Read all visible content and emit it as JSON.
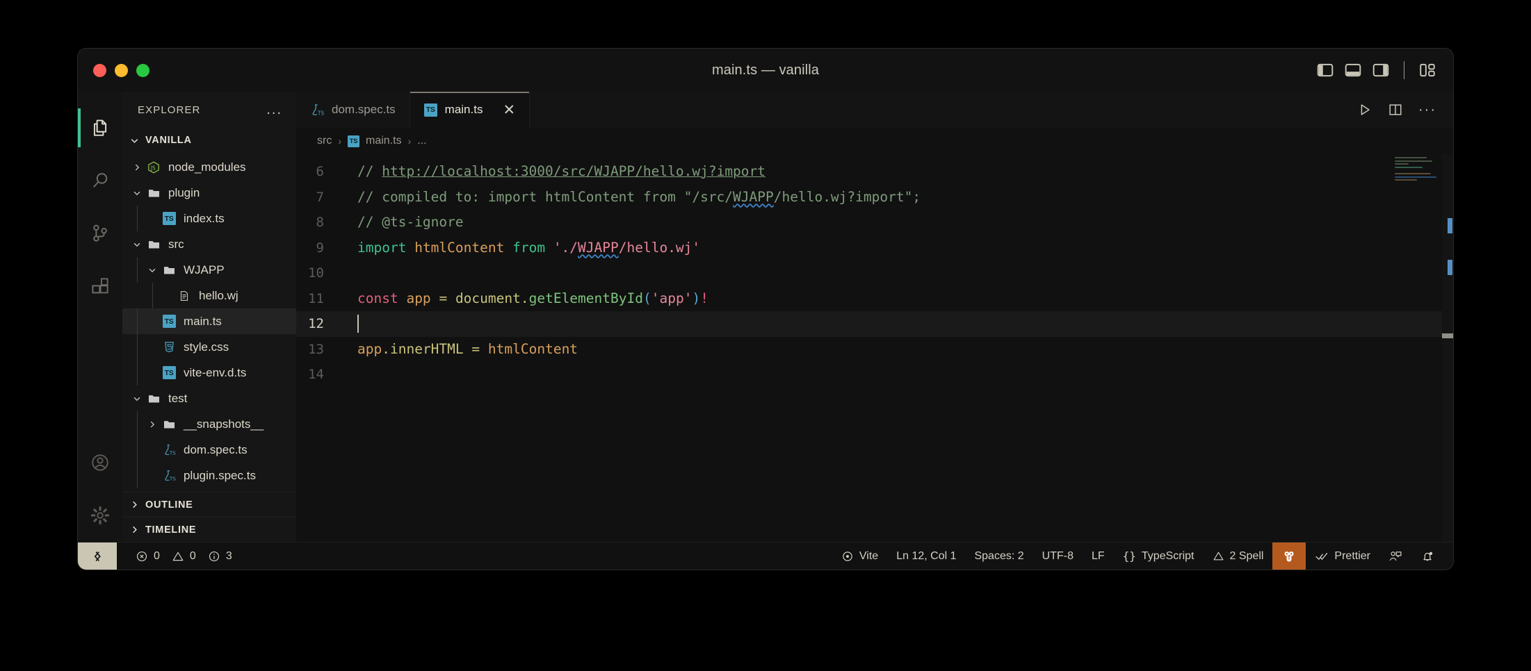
{
  "window": {
    "title": "main.ts — vanilla",
    "traffic_lights": [
      "close",
      "minimize",
      "zoom"
    ],
    "layout_controls": [
      {
        "name": "toggle-primary-sidebar",
        "icon": "layout-sidebar-left-icon"
      },
      {
        "name": "toggle-panel",
        "icon": "layout-panel-bottom-icon"
      },
      {
        "name": "toggle-secondary-sidebar",
        "icon": "layout-sidebar-right-icon"
      },
      {
        "name": "customize-layout",
        "icon": "layout-customize-icon"
      }
    ]
  },
  "activitybar": {
    "items": [
      {
        "name": "explorer",
        "icon": "files-icon",
        "active": true
      },
      {
        "name": "search",
        "icon": "search-icon",
        "active": false
      },
      {
        "name": "source-control",
        "icon": "source-control-icon",
        "active": false
      },
      {
        "name": "extensions",
        "icon": "extensions-icon",
        "active": false
      }
    ],
    "bottom_items": [
      {
        "name": "accounts",
        "icon": "account-icon"
      },
      {
        "name": "manage",
        "icon": "gear-icon"
      }
    ]
  },
  "sidebar": {
    "title": "EXPLORER",
    "more_actions": "...",
    "root": "VANILLA",
    "tree": [
      {
        "label": "node_modules",
        "icon": "nodejs-icon",
        "depth": 1,
        "twisty": "collapsed",
        "selected": false
      },
      {
        "label": "plugin",
        "icon": "folder-icon",
        "depth": 1,
        "twisty": "expanded",
        "selected": false
      },
      {
        "label": "index.ts",
        "icon": "ts-icon",
        "depth": 2,
        "twisty": "none",
        "selected": false
      },
      {
        "label": "src",
        "icon": "folder-icon",
        "depth": 1,
        "twisty": "expanded",
        "selected": false
      },
      {
        "label": "WJAPP",
        "icon": "folder-icon",
        "depth": 2,
        "twisty": "expanded",
        "selected": false
      },
      {
        "label": "hello.wj",
        "icon": "file-icon",
        "depth": 3,
        "twisty": "none",
        "selected": false
      },
      {
        "label": "main.ts",
        "icon": "ts-icon",
        "depth": 2,
        "twisty": "none",
        "selected": true
      },
      {
        "label": "style.css",
        "icon": "css-icon",
        "depth": 2,
        "twisty": "none",
        "selected": false
      },
      {
        "label": "vite-env.d.ts",
        "icon": "ts-icon",
        "depth": 2,
        "twisty": "none",
        "selected": false
      },
      {
        "label": "test",
        "icon": "folder-icon",
        "depth": 1,
        "twisty": "expanded",
        "selected": false
      },
      {
        "label": "__snapshots__",
        "icon": "folder-icon",
        "depth": 2,
        "twisty": "collapsed",
        "selected": false
      },
      {
        "label": "dom.spec.ts",
        "icon": "test-ts-icon",
        "depth": 2,
        "twisty": "none",
        "selected": false
      },
      {
        "label": "plugin.spec.ts",
        "icon": "test-ts-icon",
        "depth": 2,
        "twisty": "none",
        "selected": false
      }
    ],
    "sections": [
      {
        "label": "OUTLINE",
        "state": "collapsed"
      },
      {
        "label": "TIMELINE",
        "state": "collapsed"
      }
    ]
  },
  "editor": {
    "tabs": [
      {
        "label": "dom.spec.ts",
        "icon": "test-ts-icon",
        "active": false,
        "closable": false
      },
      {
        "label": "main.ts",
        "icon": "ts-icon",
        "active": true,
        "closable": true,
        "close_glyph": "✕"
      }
    ],
    "actions": [
      {
        "name": "run-file",
        "icon": "play-icon"
      },
      {
        "name": "split-editor-right",
        "icon": "split-editor-icon"
      },
      {
        "name": "more-editor-actions",
        "icon": "ellipsis-icon"
      }
    ],
    "breadcrumb": [
      "src",
      "main.ts",
      "..."
    ],
    "breadcrumb_separator": "›",
    "lines": [
      {
        "num": "6",
        "active": false
      },
      {
        "num": "7",
        "active": false
      },
      {
        "num": "8",
        "active": false
      },
      {
        "num": "9",
        "active": false
      },
      {
        "num": "10",
        "active": false
      },
      {
        "num": "11",
        "active": false
      },
      {
        "num": "12",
        "active": true
      },
      {
        "num": "13",
        "active": false
      },
      {
        "num": "14",
        "active": false
      }
    ],
    "text": {
      "l6_comment": "// ",
      "l6_url": "http://localhost:3000/src/WJAPP/hello.wj?import",
      "l7": "// compiled to: import htmlContent from \"/src/WJAPP/hello.wj?import\";",
      "l7_a": "// compiled to: import htmlContent from \"/src/",
      "l7_wav": "WJAPP",
      "l7_b": "/hello.wj?import\";",
      "l8": "// @ts-ignore",
      "l9_import": "import",
      "l9_ident": "htmlContent",
      "l9_from": "from",
      "l9_str_a": "'./",
      "l9_str_wav": "WJAPP",
      "l9_str_b": "/hello.wj'",
      "l11_const": "const",
      "l11_app": "app",
      "l11_eq": "=",
      "l11_document": "document",
      "l11_dot": ".",
      "l11_fn": "getElementById",
      "l11_open": "(",
      "l11_arg": "'app'",
      "l11_close": ")",
      "l11_bang": "!",
      "l13_app": "app",
      "l13_dot": ".",
      "l13_prop": "innerHTML",
      "l13_eq": "=",
      "l13_value": "htmlContent"
    }
  },
  "statusbar": {
    "remote_icon": "remote-window-icon",
    "left": [
      {
        "name": "problems",
        "icon": "error-icon",
        "text": "0",
        "icon2": "warning-icon",
        "text2": "0",
        "icon3": "info-icon",
        "text3": "3"
      }
    ],
    "problems": {
      "errors": "0",
      "warnings": "0",
      "infos": "3"
    },
    "right": [
      {
        "name": "vite",
        "icon": "vite-icon",
        "label": "Vite"
      },
      {
        "name": "editor-position",
        "label": "Ln 12, Col 1"
      },
      {
        "name": "editor-indentation",
        "label": "Spaces: 2"
      },
      {
        "name": "editor-encoding",
        "label": "UTF-8"
      },
      {
        "name": "editor-eol",
        "label": "LF"
      },
      {
        "name": "editor-language",
        "icon": "braces-icon",
        "label": "TypeScript"
      },
      {
        "name": "spell-checker",
        "icon": "warning-icon",
        "label": "2 Spell"
      },
      {
        "name": "tabnine",
        "icon": "raccoon-icon",
        "label": "",
        "accent": "#b55a1f"
      },
      {
        "name": "prettier",
        "icon": "check-all-icon",
        "label": "Prettier"
      },
      {
        "name": "feedback",
        "icon": "feedback-icon",
        "label": ""
      },
      {
        "name": "notifications",
        "icon": "bell-dot-icon",
        "label": ""
      }
    ]
  },
  "colors": {
    "accent_green": "#3ec28f",
    "ts_blue": "#4aa3c4",
    "tabnine_orange": "#b55a1f",
    "editor_bg": "#111111",
    "sidebar_bg": "#161616"
  }
}
